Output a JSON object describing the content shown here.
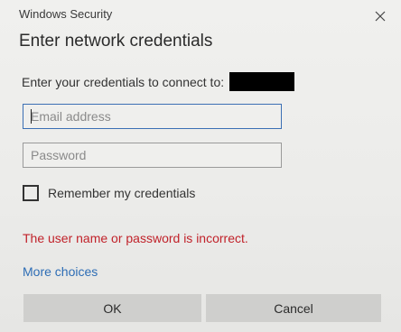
{
  "window": {
    "title": "Windows Security",
    "close_icon": "close-icon"
  },
  "dialog": {
    "heading": "Enter network credentials",
    "prompt": "Enter your credentials to connect to:"
  },
  "form": {
    "email_placeholder": "Email address",
    "email_value": "",
    "password_placeholder": "Password",
    "password_value": "",
    "remember_label": "Remember my credentials",
    "remember_checked": false
  },
  "status": {
    "error": "The user name or password is incorrect.",
    "error_color": "#c1222a"
  },
  "links": {
    "more_choices": "More choices"
  },
  "buttons": {
    "ok": "OK",
    "cancel": "Cancel"
  },
  "colors": {
    "accent": "#2d6db5",
    "focus_border": "#3b6fb4"
  }
}
